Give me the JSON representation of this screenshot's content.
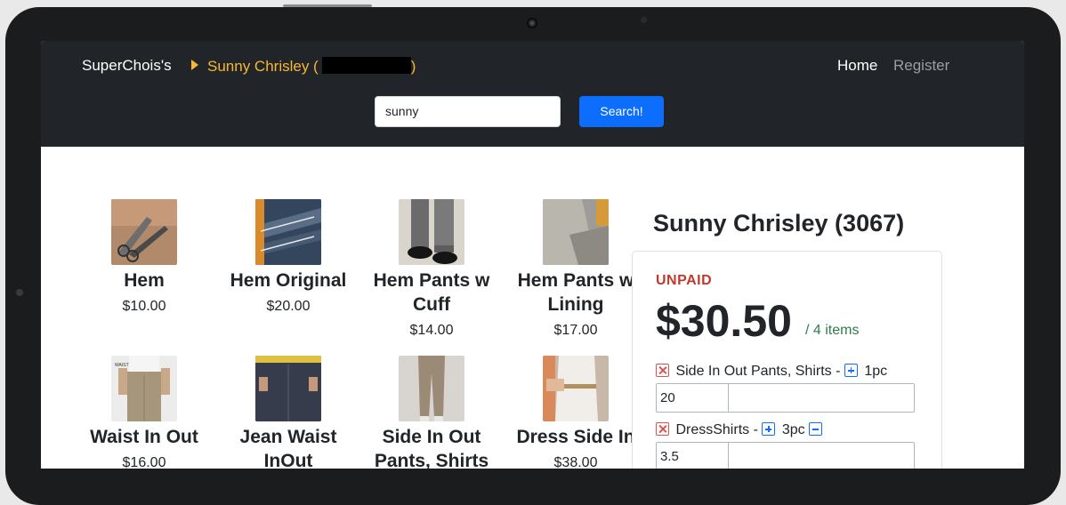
{
  "navbar": {
    "brand": "SuperChois's",
    "breadcrumb": "Sunny Chrisley (",
    "breadcrumb_end": ")",
    "home": "Home",
    "register": "Register"
  },
  "search": {
    "value": "sunny",
    "button": "Search!"
  },
  "products": [
    {
      "name": "Hem",
      "price": "$10.00",
      "icon": "hem-photo-icon"
    },
    {
      "name": "Hem Original",
      "price": "$20.00",
      "icon": "jeans-hem-photo-icon"
    },
    {
      "name": "Hem Pants w",
      "name2": "Cuff",
      "price": "$14.00",
      "icon": "pants-cuff-photo-icon"
    },
    {
      "name": "Hem Pants w",
      "name2": "Lining",
      "price": "$17.00",
      "icon": "pants-lining-photo-icon"
    },
    {
      "name": "Waist In Out",
      "price": "$16.00",
      "icon": "waist-photo-icon"
    },
    {
      "name": "Jean Waist",
      "name2": "InOut",
      "price": "",
      "icon": "jean-waist-photo-icon"
    },
    {
      "name": "Side In Out",
      "name2": "Pants, Shirts",
      "price": "",
      "icon": "side-pants-photo-icon"
    },
    {
      "name": "Dress Side In",
      "price": "$38.00",
      "icon": "dress-side-photo-icon"
    }
  ],
  "customer": {
    "title": "Sunny Chrisley (3067)",
    "status": "UNPAID",
    "total": "$30.50",
    "items": "/ 4 items",
    "status_color": "#c0392b",
    "lines": [
      {
        "text": "Side In Out Pants, Shirts -",
        "qty": "1pc",
        "value": "20"
      },
      {
        "text": "DressShirts -",
        "qty": "3pc",
        "value": "3.5"
      }
    ]
  },
  "colors": {
    "navbar": "#212529",
    "accent": "#f7b731",
    "primary": "#0d6efd"
  }
}
